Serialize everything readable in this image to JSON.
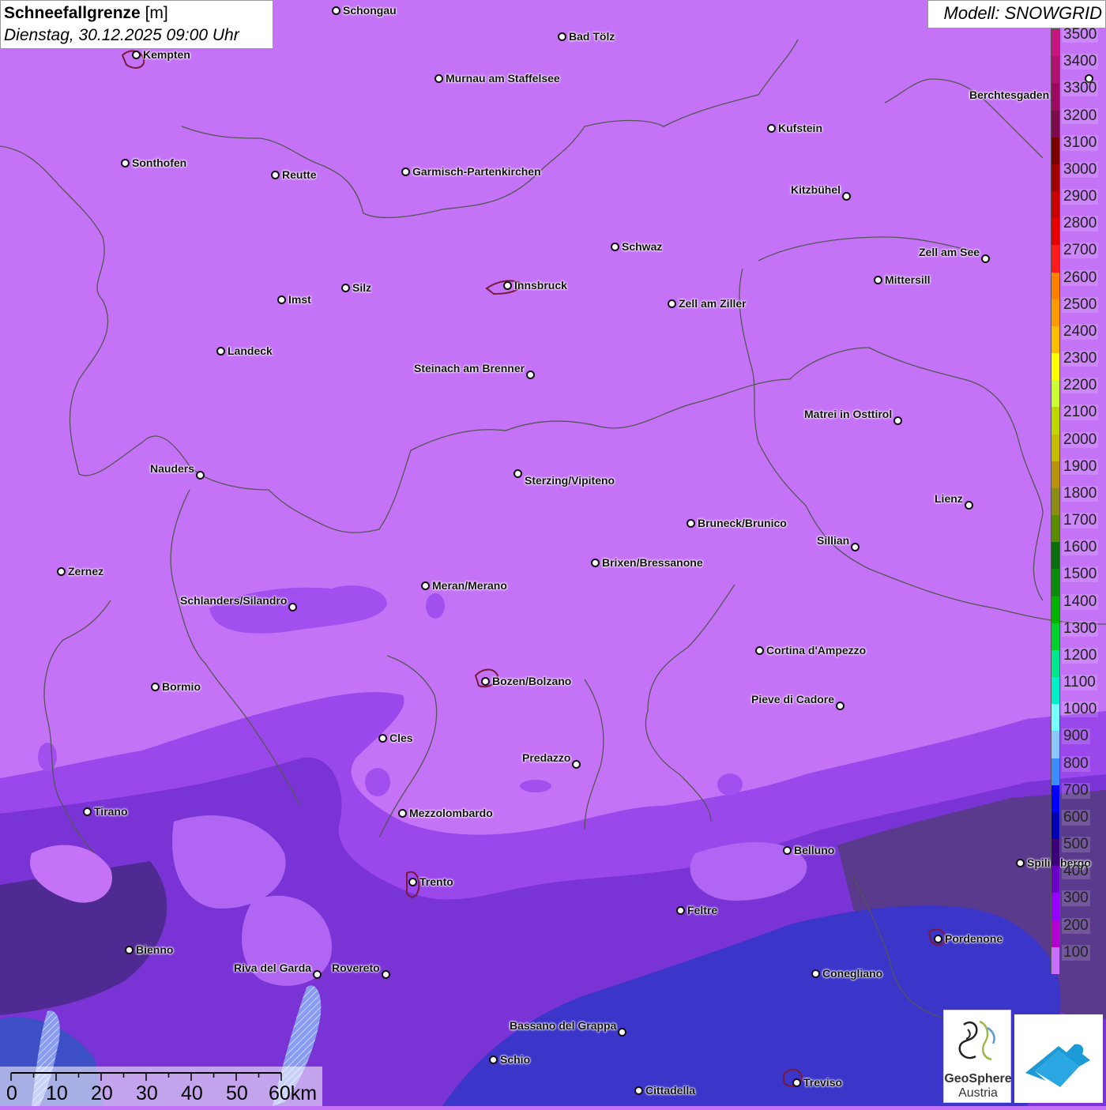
{
  "title": {
    "main": "Schneefallgrenze",
    "unit": "[m]",
    "datetime": "Dienstag, 30.12.2025 09:00 Uhr"
  },
  "model": "Modell: SNOWGRID",
  "legend": {
    "levels": [
      {
        "label": "3500",
        "color": "#c8147f"
      },
      {
        "label": "3400",
        "color": "#b2126f"
      },
      {
        "label": "3300",
        "color": "#9b0a5e"
      },
      {
        "label": "3200",
        "color": "#7d0a4a"
      },
      {
        "label": "3100",
        "color": "#7a0000"
      },
      {
        "label": "3000",
        "color": "#a00000"
      },
      {
        "label": "2900",
        "color": "#c80000"
      },
      {
        "label": "2800",
        "color": "#e60000"
      },
      {
        "label": "2700",
        "color": "#ff1a1a"
      },
      {
        "label": "2600",
        "color": "#ff7f00"
      },
      {
        "label": "2500",
        "color": "#ff9a00"
      },
      {
        "label": "2400",
        "color": "#ffbf00"
      },
      {
        "label": "2300",
        "color": "#ffff00"
      },
      {
        "label": "2200",
        "color": "#ccff33"
      },
      {
        "label": "2100",
        "color": "#bfd700"
      },
      {
        "label": "2000",
        "color": "#c7bd00"
      },
      {
        "label": "1900",
        "color": "#b8920a"
      },
      {
        "label": "1800",
        "color": "#8c8c14"
      },
      {
        "label": "1700",
        "color": "#5e8c00"
      },
      {
        "label": "1600",
        "color": "#0a6e0a"
      },
      {
        "label": "1500",
        "color": "#0a8c0a"
      },
      {
        "label": "1400",
        "color": "#00b400"
      },
      {
        "label": "1300",
        "color": "#00d22d"
      },
      {
        "label": "1200",
        "color": "#00e68c"
      },
      {
        "label": "1100",
        "color": "#00f0c8"
      },
      {
        "label": "1000",
        "color": "#78ffff"
      },
      {
        "label": "900",
        "color": "#8cc8ff"
      },
      {
        "label": "800",
        "color": "#3c8cff"
      },
      {
        "label": "700",
        "color": "#0000ff"
      },
      {
        "label": "600",
        "color": "#0000b4"
      },
      {
        "label": "500",
        "color": "#3c0078"
      },
      {
        "label": "400",
        "color": "#6a00c8"
      },
      {
        "label": "300",
        "color": "#9600ff"
      },
      {
        "label": "200",
        "color": "#b400d2"
      },
      {
        "label": "100",
        "color": "#c86eff"
      }
    ]
  },
  "cities": [
    {
      "name": "Schongau"
    },
    {
      "name": "Bad Tölz"
    },
    {
      "name": "Kempten"
    },
    {
      "name": "Murnau am Staffelsee"
    },
    {
      "name": "Berchtesgaden"
    },
    {
      "name": "Kufstein"
    },
    {
      "name": "Sonthofen"
    },
    {
      "name": "Reutte"
    },
    {
      "name": "Garmisch-Partenkirchen"
    },
    {
      "name": "Kitzbühel"
    },
    {
      "name": "Schwaz"
    },
    {
      "name": "Zell am See"
    },
    {
      "name": "Innsbruck"
    },
    {
      "name": "Mittersill"
    },
    {
      "name": "Silz"
    },
    {
      "name": "Imst"
    },
    {
      "name": "Zell am Ziller"
    },
    {
      "name": "Landeck"
    },
    {
      "name": "Steinach am Brenner"
    },
    {
      "name": "Matrei in Osttirol"
    },
    {
      "name": "Nauders"
    },
    {
      "name": "Sterzing/Vipiteno"
    },
    {
      "name": "Lienz"
    },
    {
      "name": "Bruneck/Brunico"
    },
    {
      "name": "Sillian"
    },
    {
      "name": "Zernez"
    },
    {
      "name": "Brixen/Bressanone"
    },
    {
      "name": "Meran/Merano"
    },
    {
      "name": "Schlanders/Silandro"
    },
    {
      "name": "Cortina d'Ampezzo"
    },
    {
      "name": "Bormio"
    },
    {
      "name": "Bozen/Bolzano"
    },
    {
      "name": "Pieve di Cadore"
    },
    {
      "name": "Cles"
    },
    {
      "name": "Predazzo"
    },
    {
      "name": "Tirano"
    },
    {
      "name": "Mezzolombardo"
    },
    {
      "name": "Belluno"
    },
    {
      "name": "Spilimbergo"
    },
    {
      "name": "Trento"
    },
    {
      "name": "Feltre"
    },
    {
      "name": "Pordenone"
    },
    {
      "name": "Bienno"
    },
    {
      "name": "Riva del Garda"
    },
    {
      "name": "Rovereto"
    },
    {
      "name": "Conegliano"
    },
    {
      "name": "Bassano del Grappa"
    },
    {
      "name": "Schio"
    },
    {
      "name": "Treviso"
    },
    {
      "name": "Cittadella"
    }
  ],
  "scale": {
    "labels": [
      "0",
      "10",
      "20",
      "30",
      "40",
      "50",
      "60km"
    ]
  },
  "logos": {
    "geosphere_line1": "GeoSphere",
    "geosphere_line2": "Austria"
  },
  "colors": {
    "base_fill": "#c473f7",
    "low_dark": "#5a2c9e",
    "low_mid": "#7e36e0",
    "very_low": "#3a2fb5",
    "lowland_blue": "#3b35c9",
    "border_line": "#555555"
  }
}
